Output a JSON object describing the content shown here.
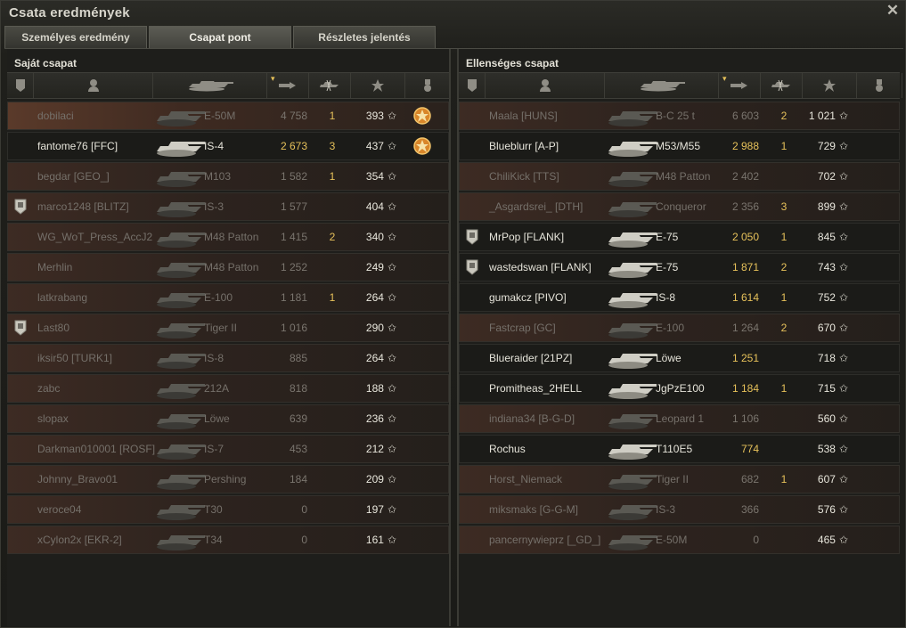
{
  "window": {
    "title": "Csata eredmények",
    "close_icon": "close-icon"
  },
  "tabs": [
    {
      "label": "Személyes eredmény",
      "active": false
    },
    {
      "label": "Csapat pont",
      "active": true
    },
    {
      "label": "Részletes jelentés",
      "active": false
    }
  ],
  "columns": {
    "badge": "badge-column-icon",
    "player": "player-column-icon",
    "tank": "tank-column-icon",
    "damage": "damage-column-icon",
    "kills": "kills-column-icon",
    "xp": "star-column-icon",
    "medal": "medal-column-icon"
  },
  "teams": [
    {
      "title": "Saját csapat",
      "rows": [
        {
          "name": "dobilaci",
          "vehicle": "E-50M",
          "damage": "4 758",
          "kills": "1",
          "xp": "393",
          "badge": false,
          "medal": true,
          "alive": false,
          "highlight": true
        },
        {
          "name": "fantome76 [FFC]",
          "vehicle": "IS-4",
          "damage": "2 673",
          "kills": "3",
          "xp": "437",
          "badge": false,
          "medal": true,
          "alive": true
        },
        {
          "name": "begdar [GEO_]",
          "vehicle": "M103",
          "damage": "1 582",
          "kills": "1",
          "xp": "354",
          "badge": false,
          "medal": false,
          "alive": false
        },
        {
          "name": "marco1248 [BLITZ]",
          "vehicle": "IS-3",
          "damage": "1 577",
          "kills": "",
          "xp": "404",
          "badge": true,
          "medal": false,
          "alive": false
        },
        {
          "name": "WG_WoT_Press_AccJ2",
          "vehicle": "M48 Patton",
          "damage": "1 415",
          "kills": "2",
          "xp": "340",
          "badge": false,
          "medal": false,
          "alive": false
        },
        {
          "name": "Merhlin",
          "vehicle": "M48 Patton",
          "damage": "1 252",
          "kills": "",
          "xp": "249",
          "badge": false,
          "medal": false,
          "alive": false
        },
        {
          "name": "latkrabang",
          "vehicle": "E-100",
          "damage": "1 181",
          "kills": "1",
          "xp": "264",
          "badge": false,
          "medal": false,
          "alive": false
        },
        {
          "name": "Last80",
          "vehicle": "Tiger II",
          "damage": "1 016",
          "kills": "",
          "xp": "290",
          "badge": true,
          "medal": false,
          "alive": false
        },
        {
          "name": "iksir50 [TURK1]",
          "vehicle": "IS-8",
          "damage": "885",
          "kills": "",
          "xp": "264",
          "badge": false,
          "medal": false,
          "alive": false
        },
        {
          "name": "zabc",
          "vehicle": "212A",
          "damage": "818",
          "kills": "",
          "xp": "188",
          "badge": false,
          "medal": false,
          "alive": false
        },
        {
          "name": "slopax",
          "vehicle": "Löwe",
          "damage": "639",
          "kills": "",
          "xp": "236",
          "badge": false,
          "medal": false,
          "alive": false
        },
        {
          "name": "Darkman010001 [ROSF]",
          "vehicle": "IS-7",
          "damage": "453",
          "kills": "",
          "xp": "212",
          "badge": false,
          "medal": false,
          "alive": false
        },
        {
          "name": "Johnny_Bravo01",
          "vehicle": "Pershing",
          "damage": "184",
          "kills": "",
          "xp": "209",
          "badge": false,
          "medal": false,
          "alive": false
        },
        {
          "name": "veroce04",
          "vehicle": "T30",
          "damage": "0",
          "kills": "",
          "xp": "197",
          "badge": false,
          "medal": false,
          "alive": false
        },
        {
          "name": "xCylon2x [EKR-2]",
          "vehicle": "T34",
          "damage": "0",
          "kills": "",
          "xp": "161",
          "badge": false,
          "medal": false,
          "alive": false
        }
      ]
    },
    {
      "title": "Ellenséges csapat",
      "rows": [
        {
          "name": "Maala [HUNS]",
          "vehicle": "B-C 25 t",
          "damage": "6 603",
          "kills": "2",
          "xp": "1 021",
          "badge": false,
          "medal": false,
          "alive": false
        },
        {
          "name": "Blueblurr [A-P]",
          "vehicle": "M53/M55",
          "damage": "2 988",
          "kills": "1",
          "xp": "729",
          "badge": false,
          "medal": false,
          "alive": true
        },
        {
          "name": "ChiliKick [TTS]",
          "vehicle": "M48 Patton",
          "damage": "2 402",
          "kills": "",
          "xp": "702",
          "badge": false,
          "medal": false,
          "alive": false
        },
        {
          "name": "_Asgardsrei_ [DTH]",
          "vehicle": "Conqueror",
          "damage": "2 356",
          "kills": "3",
          "xp": "899",
          "badge": false,
          "medal": false,
          "alive": false
        },
        {
          "name": "MrPop [FLANK]",
          "vehicle": "E-75",
          "damage": "2 050",
          "kills": "1",
          "xp": "845",
          "badge": true,
          "medal": false,
          "alive": true
        },
        {
          "name": "wastedswan [FLANK]",
          "vehicle": "E-75",
          "damage": "1 871",
          "kills": "2",
          "xp": "743",
          "badge": true,
          "medal": false,
          "alive": true
        },
        {
          "name": "gumakcz [PIVO]",
          "vehicle": "IS-8",
          "damage": "1 614",
          "kills": "1",
          "xp": "752",
          "badge": false,
          "medal": false,
          "alive": true
        },
        {
          "name": "Fastcrap [GC]",
          "vehicle": "E-100",
          "damage": "1 264",
          "kills": "2",
          "xp": "670",
          "badge": false,
          "medal": false,
          "alive": false
        },
        {
          "name": "Blueraider [21PZ]",
          "vehicle": "Löwe",
          "damage": "1 251",
          "kills": "",
          "xp": "718",
          "badge": false,
          "medal": false,
          "alive": true
        },
        {
          "name": "Promitheas_2HELL",
          "vehicle": "JgPzE100",
          "damage": "1 184",
          "kills": "1",
          "xp": "715",
          "badge": false,
          "medal": false,
          "alive": true
        },
        {
          "name": "indiana34 [B-G-D]",
          "vehicle": "Leopard 1",
          "damage": "1 106",
          "kills": "",
          "xp": "560",
          "badge": false,
          "medal": false,
          "alive": false
        },
        {
          "name": "Rochus",
          "vehicle": "T110E5",
          "damage": "774",
          "kills": "",
          "xp": "538",
          "badge": false,
          "medal": false,
          "alive": true
        },
        {
          "name": "Horst_Niemack",
          "vehicle": "Tiger II",
          "damage": "682",
          "kills": "1",
          "xp": "607",
          "badge": false,
          "medal": false,
          "alive": false
        },
        {
          "name": "miksmaks [G-G-M]",
          "vehicle": "IS-3",
          "damage": "366",
          "kills": "",
          "xp": "576",
          "badge": false,
          "medal": false,
          "alive": false
        },
        {
          "name": "pancernywieprz [_GD_]",
          "vehicle": "E-50M",
          "damage": "0",
          "kills": "",
          "xp": "465",
          "badge": false,
          "medal": false,
          "alive": false
        }
      ]
    }
  ],
  "colors": {
    "damage_alive": "#e6c15a",
    "kills": "#e6c15a",
    "dead_row": "#3d2b23",
    "medal": "#d9862a"
  }
}
